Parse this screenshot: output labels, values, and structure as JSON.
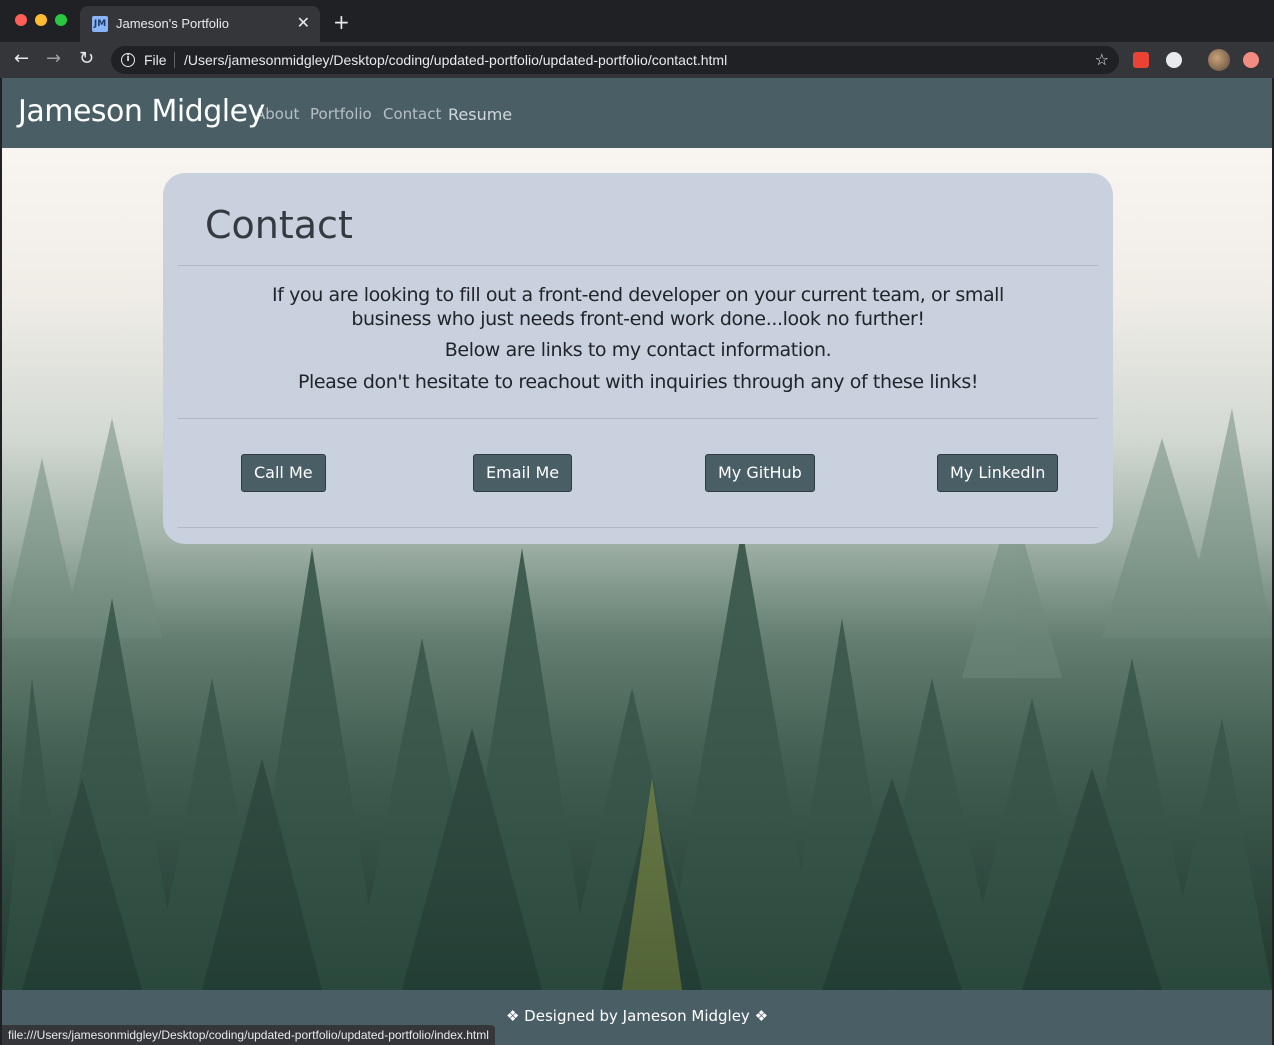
{
  "browser": {
    "tab_title": "Jameson's Portfolio",
    "favicon_text": "JM",
    "scheme_label": "File",
    "url": "/Users/jamesonmidgley/Desktop/coding/updated-portfolio/updated-portfolio/contact.html",
    "status_url": "file:///Users/jamesonmidgley/Desktop/coding/updated-portfolio/updated-portfolio/index.html"
  },
  "navbar": {
    "brand": "Jameson Midgley",
    "links": [
      "About",
      "Portfolio",
      "Contact",
      "Resume"
    ]
  },
  "contact": {
    "title": "Contact",
    "paragraph1_line1": "If you are looking to fill out a front-end developer on your current team, or small",
    "paragraph1_line2": "business who just needs front-end work done...look no further!",
    "paragraph2": "Below are links to my contact information.",
    "paragraph3": "Please don't hesitate to reachout with inquiries through any of these links!",
    "buttons": [
      "Call Me",
      "Email Me",
      "My GitHub",
      "My LinkedIn"
    ]
  },
  "footer": {
    "text": "❖ Designed by Jameson Midgley ❖"
  },
  "colors": {
    "navbar": "#4a5e66",
    "card": "#c8d1dd",
    "button": "#4a5e66"
  }
}
